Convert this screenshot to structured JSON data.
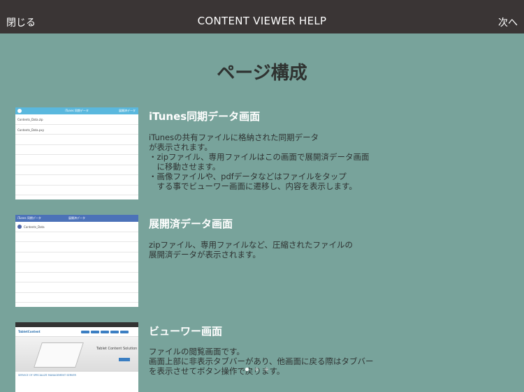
{
  "navbar": {
    "close_label": "閉じる",
    "title": "CONTENT VIEWER HELP",
    "next_label": "次へ"
  },
  "page": {
    "title": "ページ構成"
  },
  "sections": [
    {
      "title": "iTunes同期データ画面",
      "description": "iTunesの共有ファイルに格納された同期データ\nが表示されます。\n・zipファイル、専用ファイルはこの画面で展開済データ画面\n　に移動させます。\n・画像ファイルや、pdfデータなどはファイルをタップ\n　する事でビューワー画面に遷移し、内容を表示します。",
      "thumb": {
        "bar_title": "iTunes 同期データ",
        "bar_right": "展開済データ",
        "rows": [
          "Contents_Data.zip",
          "Contents_Data.pxy"
        ]
      }
    },
    {
      "title": "展開済データ画面",
      "description": "zipファイル、専用ファイルなど、圧縮されたファイルの\n展開済データが表示されます。",
      "thumb": {
        "bar_left": "iTunes 同期データ",
        "bar_title": "展開済データ",
        "rows": [
          "Contents_Data"
        ]
      }
    },
    {
      "title": "ビューワー画面",
      "description": "ファイルの閲覧画面です。\n画面上部に非表示タブバーがあり、他画面に戻る際はタブバー\nを表示させてボタン操作で戻ります。",
      "thumb": {
        "logo": "TabletContent",
        "hero_text": "Tablet Content Solution",
        "footer_text": "SERVICE OF SPECIALIZE MANAGEMENT SERVER"
      }
    }
  ],
  "colors": {
    "background": "#78a39b",
    "navbar": "#3a3535",
    "itunes_bar": "#5ab8de",
    "expanded_bar": "#4c72b8"
  },
  "pager": {
    "count": 3,
    "active_index": 0
  }
}
